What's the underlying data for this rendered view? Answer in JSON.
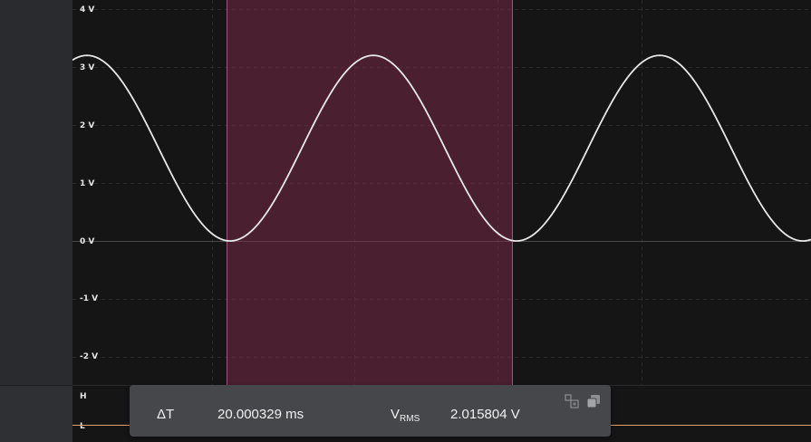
{
  "plot": {
    "y_axis_labels": [
      "4 V",
      "3 V",
      "2 V",
      "1 V",
      "0 V",
      "-1 V",
      "-2 V"
    ]
  },
  "digital_channel": {
    "high_label": "H",
    "low_label": "L",
    "line_color": "#e6a06a"
  },
  "cursor_region": {
    "color": "#7a2a48"
  },
  "measurement_panel": {
    "delta_t_label": "ΔT",
    "delta_t_value": "20.000329 ms",
    "vrms_label": "V",
    "vrms_subscript": "RMS",
    "vrms_value": "2.015804 V",
    "icons": [
      "expand-view-icon",
      "copy-icon"
    ]
  },
  "colors": {
    "background": "#151516",
    "trace": "#e8e8e8",
    "grid": "#2a2a2c"
  }
}
